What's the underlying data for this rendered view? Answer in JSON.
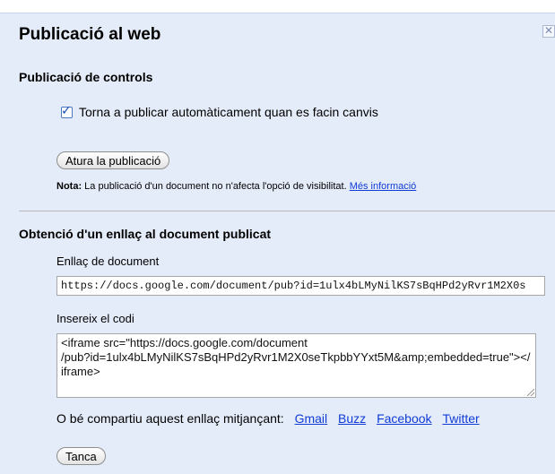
{
  "dialog": {
    "title": "Publicació al web",
    "close_glyph": "✕"
  },
  "publishing_controls": {
    "heading": "Publicació de controls",
    "auto_republish_label": "Torna a publicar automàticament quan es facin canvis",
    "auto_republish_checked": true,
    "stop_button_label": "Atura la publicació",
    "note_bold": "Nota:",
    "note_text": " La publicació d'un document no n'afecta l'opció de visibilitat.",
    "note_link": "Més informació"
  },
  "published_link": {
    "heading": "Obtenció d'un enllaç al document publicat",
    "doc_link_label": "Enllaç de document",
    "doc_link_value": "https://docs.google.com/document/pub?id=1ulx4bLMyNilKS7sBqHPd2yRvr1M2X0s",
    "embed_label": "Insereix el codi",
    "embed_code": "<iframe src=\"https://docs.google.com/document\n/pub?id=1ulx4bLMyNilKS7sBqHPd2yRvr1M2X0seTkpbbYYxt5M&amp;embedded=true\"></iframe>",
    "share_prefix": "O bé compartiu aquest enllaç mitjançant:",
    "share_links": [
      "Gmail",
      "Buzz",
      "Facebook",
      "Twitter"
    ]
  },
  "footer": {
    "close_button_label": "Tanca"
  },
  "colors": {
    "dialog_background": "#e5ecf9",
    "link": "#0f3bd6"
  }
}
